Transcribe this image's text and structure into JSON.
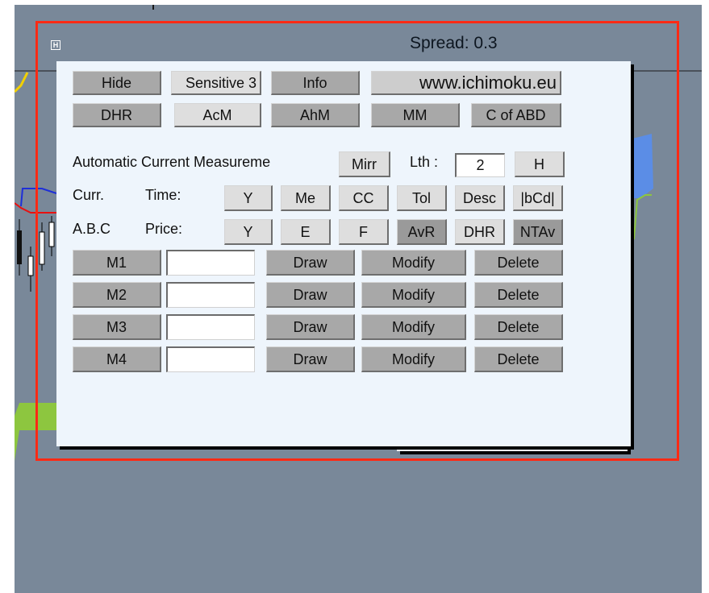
{
  "header": {
    "spread_text": "Spread: 0.3",
    "collapse_glyph": "H"
  },
  "top_rows": [
    [
      "Hide",
      "Sensitive 3",
      "Info",
      "www.ichimoku.eu"
    ],
    [
      "DHR",
      "AcM",
      "AhM",
      "MM",
      "C of ABD"
    ]
  ],
  "measurement": {
    "title": "Automatic Current Measureme",
    "mirr_label": "Mirr",
    "lth_label": "Lth :",
    "lth_value": "2",
    "h_label": "H"
  },
  "curr_row": {
    "label": "Curr.",
    "sub_label": "Time:",
    "buttons": [
      "Y",
      "Me",
      "CC",
      "Tol",
      "Desc",
      "|bCd|"
    ]
  },
  "abc_row": {
    "label": "A.B.C",
    "sub_label": "Price:",
    "buttons": [
      "Y",
      "E",
      "F",
      "AvR",
      "DHR",
      "NTAv"
    ]
  },
  "measures": [
    {
      "name": "M1",
      "value": "",
      "draw": "Draw",
      "modify": "Modify",
      "delete": "Delete"
    },
    {
      "name": "M2",
      "value": "",
      "draw": "Draw",
      "modify": "Modify",
      "delete": "Delete"
    },
    {
      "name": "M3",
      "value": "",
      "draw": "Draw",
      "modify": "Modify",
      "delete": "Delete"
    },
    {
      "name": "M4",
      "value": "",
      "draw": "Draw",
      "modify": "Modify",
      "delete": "Delete"
    }
  ],
  "colors": {
    "chart_background": "#798899",
    "highlight_border": "#ff2a14",
    "panel_background": "#eef5fc",
    "button_gray": "#a8a8a8"
  }
}
